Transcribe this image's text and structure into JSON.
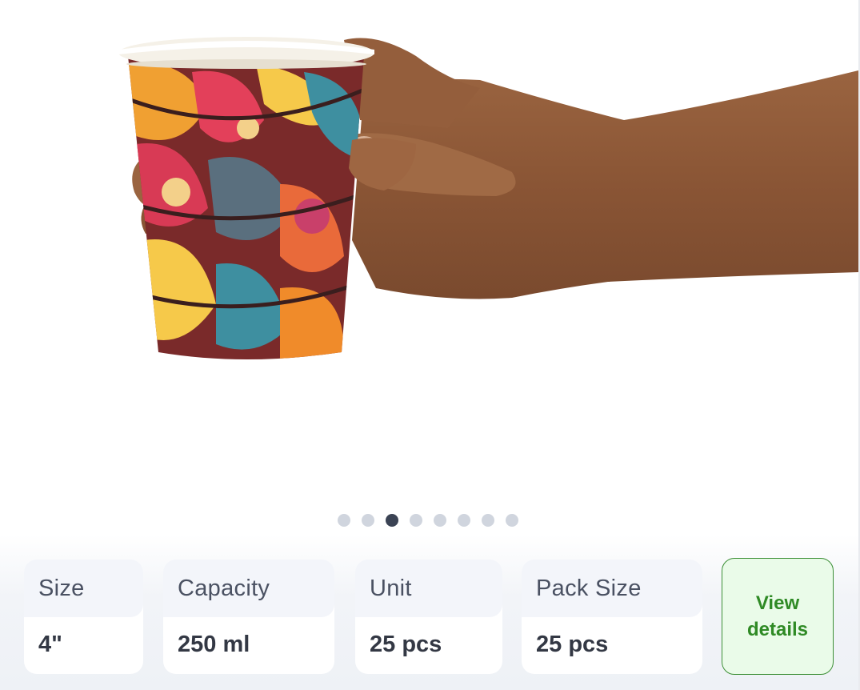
{
  "carousel": {
    "dots_count": 8,
    "active_index": 2,
    "dot_color": "#d0d5de",
    "active_dot_color": "#3b4354"
  },
  "product_image": {
    "subject": "hand holding a patterned paper cup"
  },
  "specs": [
    {
      "label": "Size",
      "value": "4\""
    },
    {
      "label": "Capacity",
      "value": "250 ml"
    },
    {
      "label": "Unit",
      "value": "25 pcs"
    },
    {
      "label": "Pack Size",
      "value": "25 pcs"
    }
  ],
  "view_details": {
    "line1": "View",
    "line2": "details",
    "accent": "#2f8a25"
  }
}
